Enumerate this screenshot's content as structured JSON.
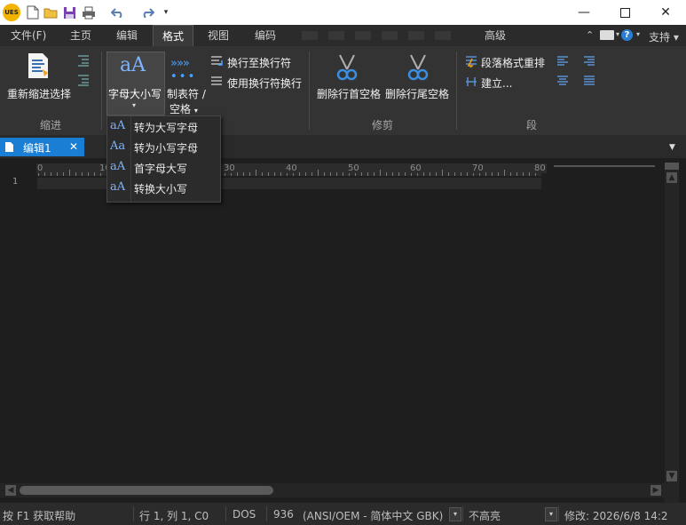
{
  "app": {
    "logo_text": "UES"
  },
  "tabs": [
    "文件(F)",
    "主页",
    "编辑",
    "格式",
    "视图",
    "编码",
    "高级"
  ],
  "active_tab": "格式",
  "support_label": "支持",
  "ribbon": {
    "indent": {
      "reindent_label": "重新缩进选择",
      "group_label": "缩进"
    },
    "case": {
      "case_label": "字母大小写",
      "case_icon": "aA",
      "tabs_label_1": "制表符 /",
      "tabs_label_2": "空格",
      "tab_to_newline": "换行至换行符",
      "use_newline_wrap": "使用换行符换行"
    },
    "trim": {
      "trim_leading": "删除行首空格",
      "trim_trailing": "删除行尾空格",
      "group_label": "修剪"
    },
    "paragraph": {
      "reformat": "段落格式重排",
      "build": "建立...",
      "group_label": "段"
    }
  },
  "dropdown": {
    "items": [
      {
        "icon": "aA",
        "label": "转为大写字母"
      },
      {
        "icon": "Aa",
        "label": "转为小写字母"
      },
      {
        "icon": "aA",
        "label": "首字母大写"
      },
      {
        "icon": "aA",
        "label": "转换大小写"
      }
    ]
  },
  "document": {
    "tab_label": "编辑1",
    "line_number": "1"
  },
  "ruler": {
    "marks": [
      "0",
      "10",
      "20",
      "30",
      "40",
      "50",
      "60",
      "70",
      "80"
    ]
  },
  "status": {
    "help": "按 F1 获取帮助",
    "position": "行 1, 列 1, C0",
    "line_ending": "DOS",
    "codepage": "936",
    "encoding": "(ANSI/OEM - 简体中文 GBK)",
    "highlight": "不高亮",
    "modified": "修改:   2026/6/8 14:2"
  },
  "colors": {
    "accent": "#1a7fd4",
    "background": "#1e1e1e",
    "ribbon": "#333333"
  }
}
